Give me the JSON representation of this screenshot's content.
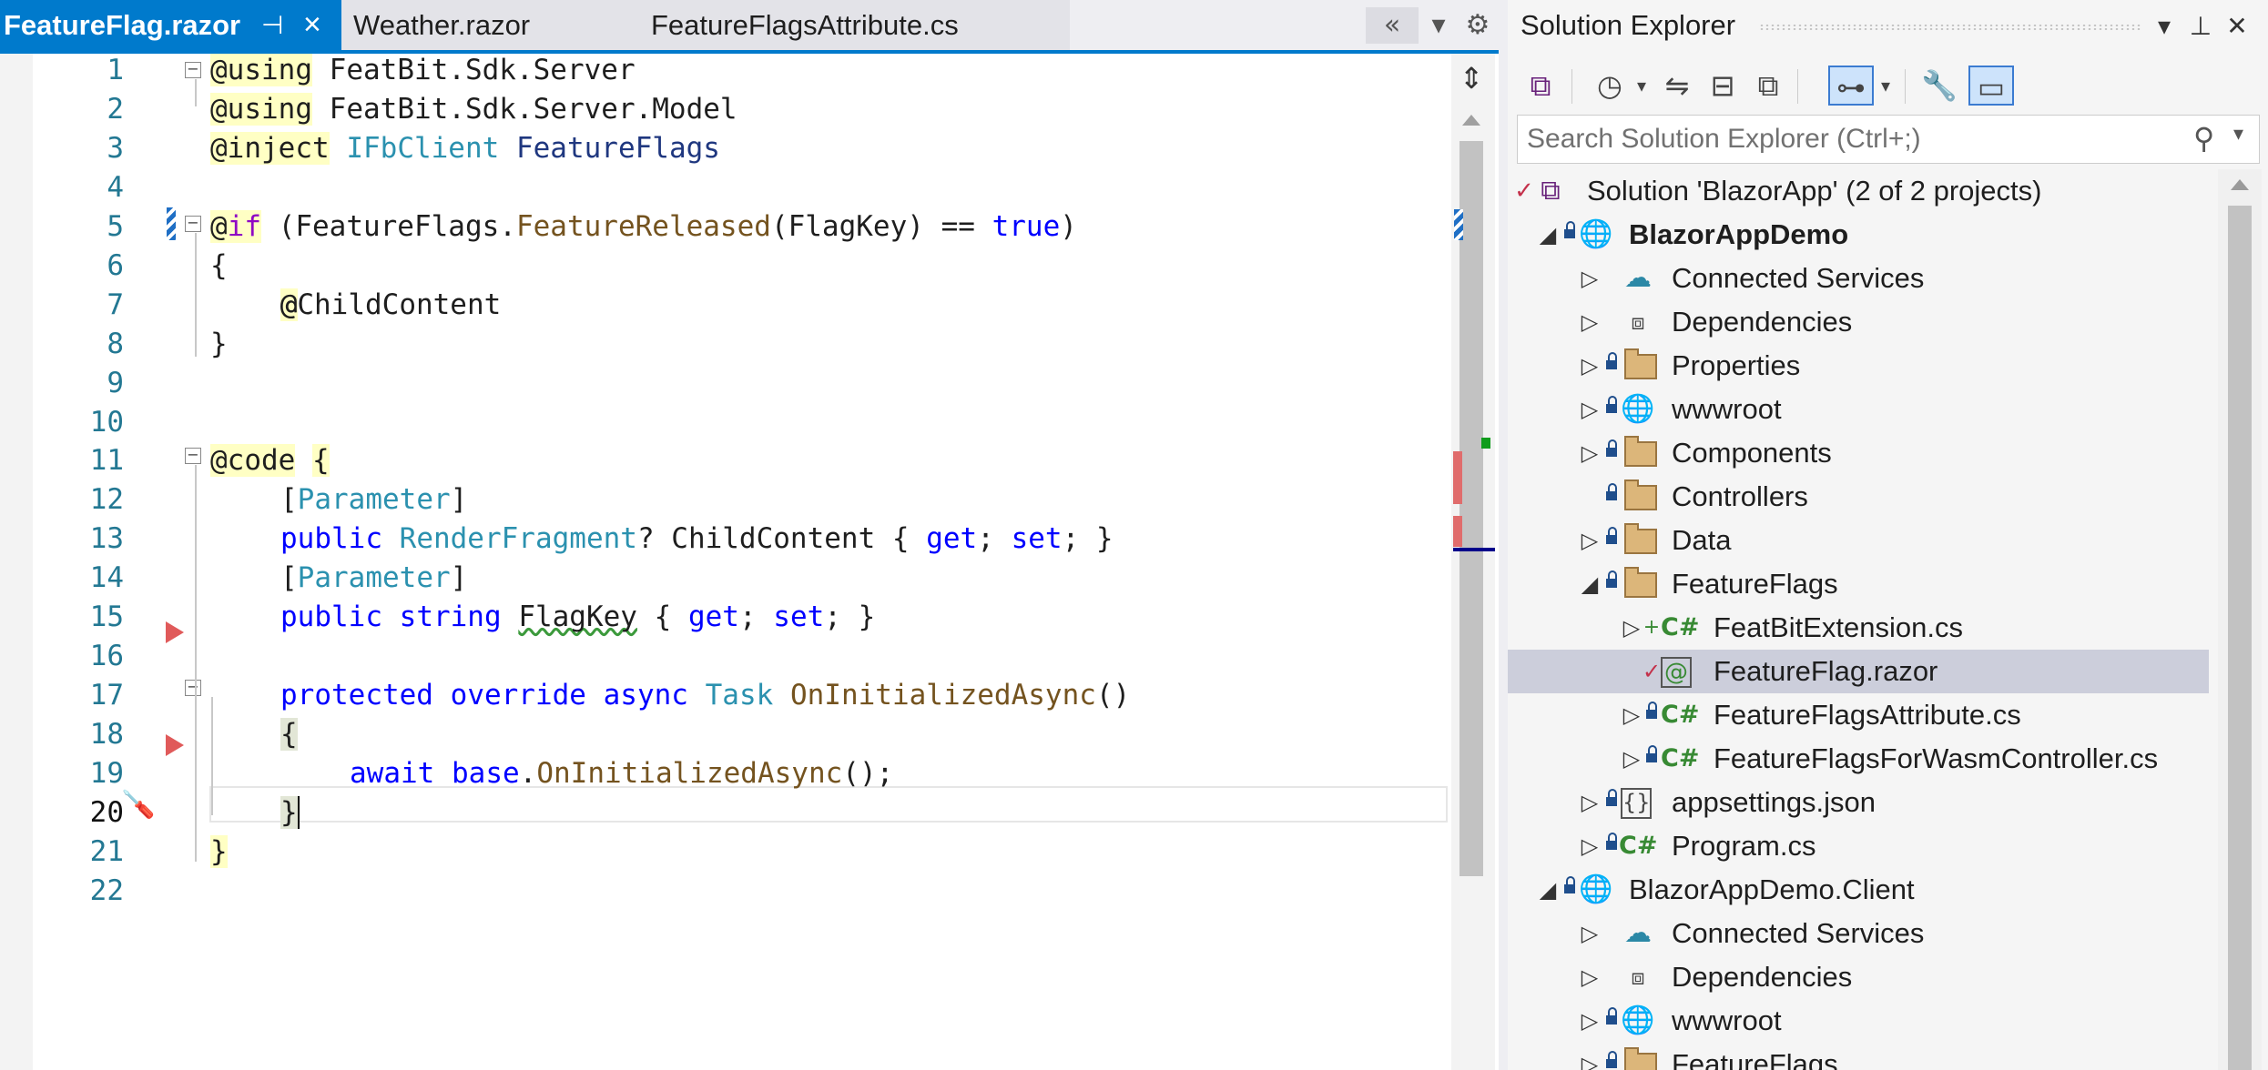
{
  "editor": {
    "tabs": [
      {
        "label": "FeatureFlag.razor",
        "active": true
      },
      {
        "label": "Weather.razor",
        "active": false
      },
      {
        "label": "FeatureFlagsAttribute.cs",
        "active": false
      }
    ],
    "pin_glyph": "⊣",
    "close_glyph": "×",
    "overflow_glyph": "«",
    "dropdown_glyph": "▾",
    "settings_glyph": "⚙",
    "current_line": 20,
    "line_count": 22
  },
  "solution_explorer": {
    "title": "Solution Explorer",
    "search_placeholder": "Search Solution Explorer (Ctrl+;)",
    "solution_label": "Solution 'BlazorApp' (2 of 2 projects)",
    "items": [
      {
        "label": "BlazorAppDemo",
        "icon": "project-icon",
        "bold": true
      },
      {
        "label": "Connected Services",
        "icon": "connected-services-icon"
      },
      {
        "label": "Dependencies",
        "icon": "dependencies-icon"
      },
      {
        "label": "Properties",
        "icon": "properties-icon"
      },
      {
        "label": "wwwroot",
        "icon": "globe-icon"
      },
      {
        "label": "Components",
        "icon": "folder-icon"
      },
      {
        "label": "Controllers",
        "icon": "folder-icon"
      },
      {
        "label": "Data",
        "icon": "folder-icon"
      },
      {
        "label": "FeatureFlags",
        "icon": "folder-open-icon"
      },
      {
        "label": "FeatBitExtension.cs",
        "icon": "csharp-file-icon"
      },
      {
        "label": "FeatureFlag.razor",
        "icon": "razor-file-icon",
        "selected": true
      },
      {
        "label": "FeatureFlagsAttribute.cs",
        "icon": "csharp-file-icon"
      },
      {
        "label": "FeatureFlagsForWasmController.cs",
        "icon": "csharp-file-icon"
      },
      {
        "label": "appsettings.json",
        "icon": "json-file-icon"
      },
      {
        "label": "Program.cs",
        "icon": "csharp-file-icon"
      },
      {
        "label": "BlazorAppDemo.Client",
        "icon": "project-icon"
      },
      {
        "label": "Connected Services",
        "icon": "connected-services-icon"
      },
      {
        "label": "Dependencies",
        "icon": "dependencies-icon"
      },
      {
        "label": "wwwroot",
        "icon": "globe-icon"
      },
      {
        "label": "FeatureFlags",
        "icon": "folder-icon"
      }
    ]
  },
  "colors": {
    "accent": "#007acc",
    "keyword": "#0000ff",
    "type": "#2b91af",
    "method": "#74531f",
    "razor_bg": "#ffffc4",
    "breakpoint": "#e05a5a",
    "selection": "#cccedb",
    "csharp": "#388a34"
  },
  "code": {
    "t1": "using",
    "t2": " FeatBit.Sdk.Server",
    "t3": "using",
    "t4": " FeatBit.Sdk.Server.Model",
    "t5": "inject",
    "t6": "IFbClient",
    "t7": "FeatureFlags",
    "t8": "if",
    "t9": " (FeatureFlags.",
    "t10": "FeatureReleased",
    "t11": "(FlagKey) == ",
    "t12": "true",
    "t13": ")",
    "t14": "{",
    "t15": "@ChildContent",
    "t16": "}",
    "t17": "code",
    "t18": "{",
    "t19": "[",
    "t20": "Parameter",
    "t21": "]",
    "t22": "public",
    "t23": "RenderFragment",
    "t24": "? ChildContent { ",
    "t25": "get",
    "t26": "; ",
    "t27": "set",
    "t28": "; }",
    "t29": "[",
    "t30": "Parameter",
    "t31": "]",
    "t32": "public",
    "t33": "string",
    "t34": "FlagKey",
    "t35": " { ",
    "t36": "get",
    "t37": "; ",
    "t38": "set",
    "t39": "; }",
    "t40": "protected",
    "t41": "override",
    "t42": "async",
    "t43": "Task",
    "t44": "OnInitializedAsync",
    "t45": "()",
    "t46": "{",
    "t47": "await",
    "t48": "base",
    "t49": ".",
    "t50": "OnInitializedAsync",
    "t51": "();",
    "t52": "}",
    "t53": "}",
    "at": "@"
  }
}
